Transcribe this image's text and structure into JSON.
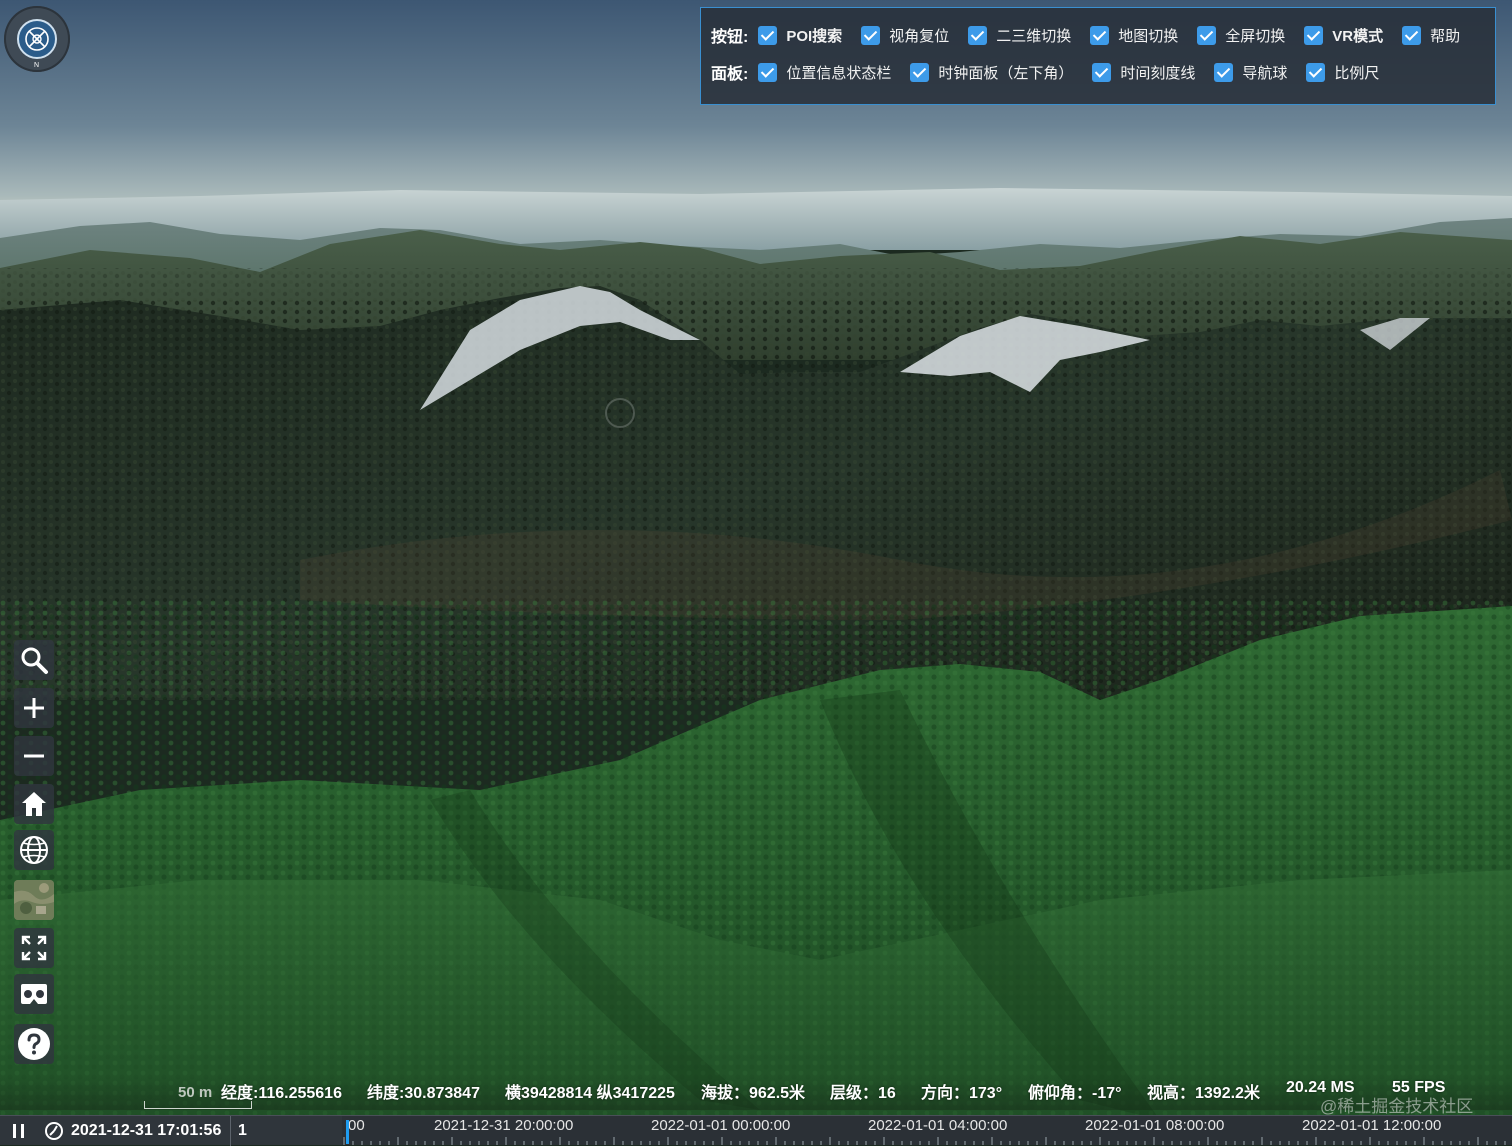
{
  "panel": {
    "buttons_label": "按钮:",
    "panels_label": "面板:",
    "buttons": [
      {
        "label": "POI搜索",
        "checked": true
      },
      {
        "label": "视角复位",
        "checked": true
      },
      {
        "label": "二三维切换",
        "checked": true
      },
      {
        "label": "地图切换",
        "checked": true
      },
      {
        "label": "全屏切换",
        "checked": true
      },
      {
        "label": "VR模式",
        "checked": true
      },
      {
        "label": "帮助",
        "checked": true
      }
    ],
    "panels": [
      {
        "label": "位置信息状态栏",
        "checked": true
      },
      {
        "label": "时钟面板（左下角）",
        "checked": true
      },
      {
        "label": "时间刻度线",
        "checked": true
      },
      {
        "label": "导航球",
        "checked": true
      },
      {
        "label": "比例尺",
        "checked": true
      }
    ]
  },
  "toolbar": {
    "icons": [
      "search-icon",
      "zoom-in-icon",
      "zoom-out-icon",
      "home-icon",
      "globe-icon",
      "basemap-thumbnail",
      "fullscreen-icon",
      "vr-icon",
      "help-icon"
    ]
  },
  "compass": {
    "north_label": "N"
  },
  "scale": {
    "label": "50 m"
  },
  "status": {
    "longitude": "经度:116.255616",
    "latitude": "纬度:30.873847",
    "projected": "横39428814 纵3417225",
    "altitude": "海拔：962.5米",
    "level": "层级：16",
    "heading": "方向：173°",
    "pitch": "俯仰角：-17°",
    "view_height": "视高：1392.2米",
    "ms": "20.24 MS",
    "fps": "55 FPS"
  },
  "clock": {
    "datetime": "2021-12-31 17:01:56",
    "speed": "1"
  },
  "timeline": {
    "labels": [
      "00",
      "2021-12-31 20:00:00",
      "2022-01-01 00:00:00",
      "2022-01-01 04:00:00",
      "2022-01-01 08:00:00",
      "2022-01-01 12:00:00"
    ]
  },
  "watermark": "@稀土掘金技术社区",
  "colors": {
    "accent": "#3d9be9",
    "panel_border": "#3a8fd0",
    "timeline_needle": "#1f9cf0"
  }
}
